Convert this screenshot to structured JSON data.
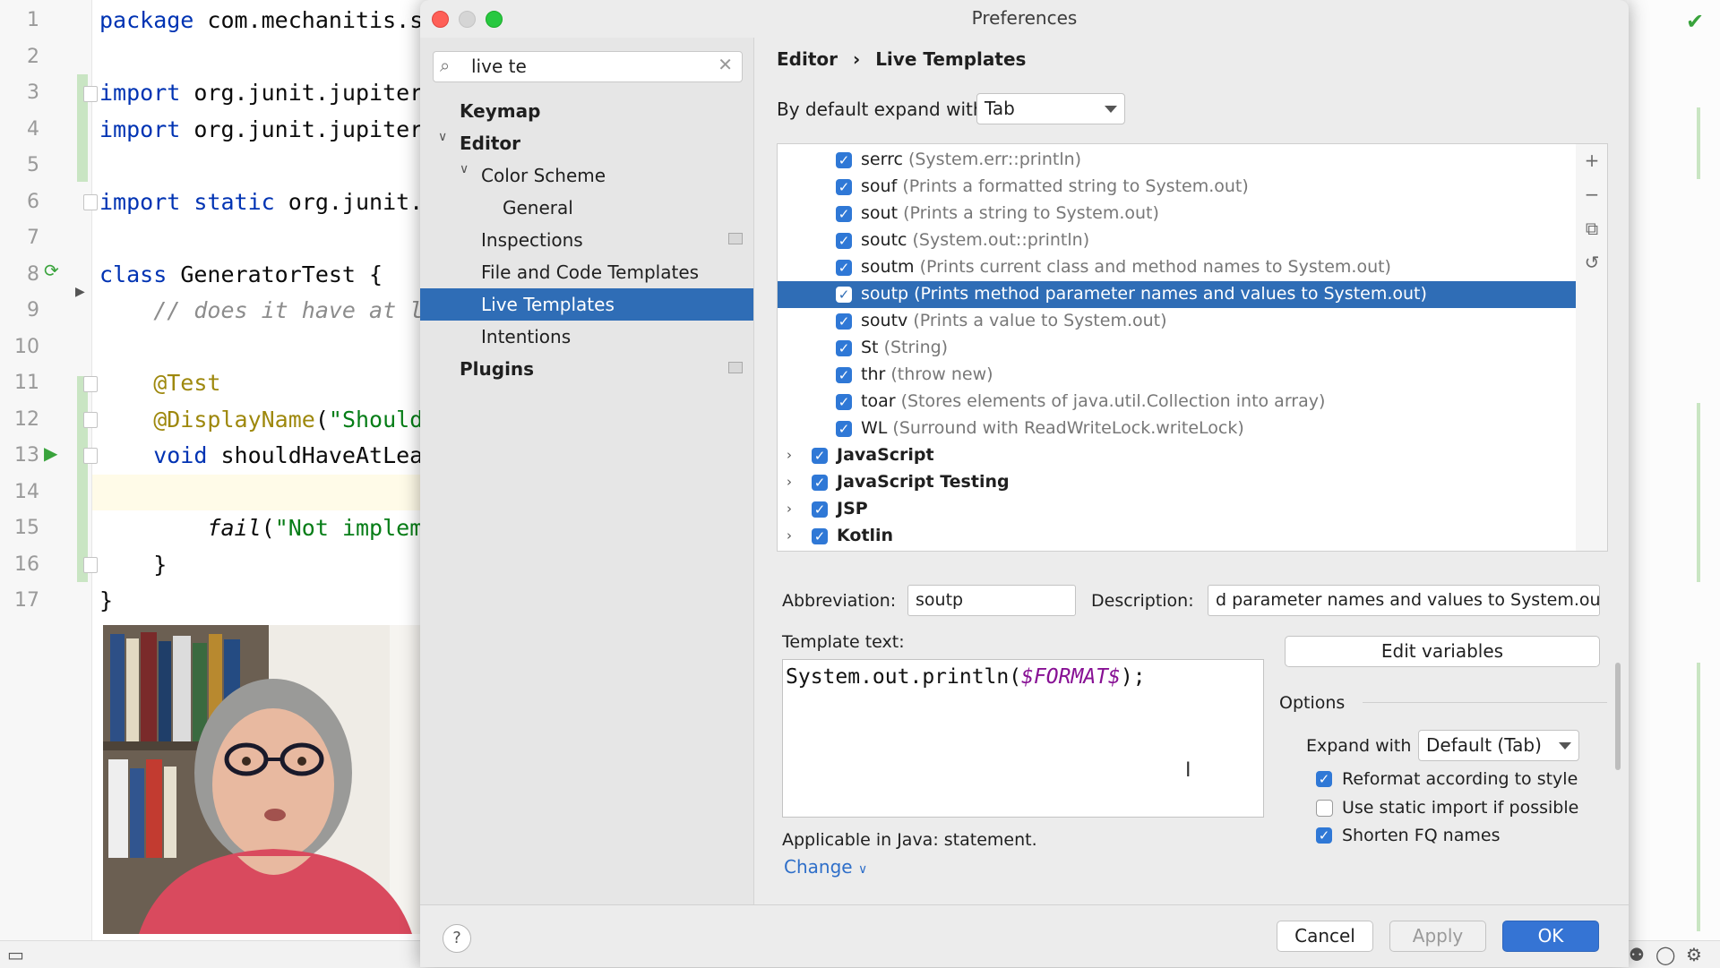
{
  "editor": {
    "lines": [
      {
        "num": "1",
        "html_parts": [
          {
            "t": "package ",
            "c": "kw"
          },
          {
            "t": "com.mechanitis.s",
            "c": ""
          }
        ]
      },
      {
        "num": "2",
        "html_parts": []
      },
      {
        "num": "3",
        "html_parts": [
          {
            "t": "import ",
            "c": "kw"
          },
          {
            "t": "org.junit.jupiter",
            "c": ""
          }
        ]
      },
      {
        "num": "4",
        "html_parts": [
          {
            "t": "import ",
            "c": "kw"
          },
          {
            "t": "org.junit.jupiter",
            "c": ""
          }
        ]
      },
      {
        "num": "5",
        "html_parts": []
      },
      {
        "num": "6",
        "html_parts": [
          {
            "t": "import static ",
            "c": "kw"
          },
          {
            "t": "org.junit.",
            "c": ""
          }
        ]
      },
      {
        "num": "7",
        "html_parts": []
      },
      {
        "num": "8",
        "html_parts": [
          {
            "t": "class ",
            "c": "kw"
          },
          {
            "t": "GeneratorTest {",
            "c": ""
          }
        ]
      },
      {
        "num": "9",
        "html_parts": [
          {
            "t": "    // does it have at l",
            "c": "cm"
          }
        ]
      },
      {
        "num": "10",
        "html_parts": []
      },
      {
        "num": "11",
        "html_parts": [
          {
            "t": "    @Test",
            "c": "an"
          }
        ]
      },
      {
        "num": "12",
        "html_parts": [
          {
            "t": "    @DisplayName",
            "c": "an"
          },
          {
            "t": "(",
            "c": ""
          },
          {
            "t": "\"Should",
            "c": "str"
          }
        ]
      },
      {
        "num": "13",
        "html_parts": [
          {
            "t": "    void ",
            "c": "kw"
          },
          {
            "t": "shouldHaveAtLea",
            "c": ""
          }
        ]
      },
      {
        "num": "14",
        "html_parts": []
      },
      {
        "num": "15",
        "html_parts": [
          {
            "t": "        ",
            "c": ""
          },
          {
            "t": "fail",
            "c": "it"
          },
          {
            "t": "(",
            "c": ""
          },
          {
            "t": "\"Not implem",
            "c": "str"
          }
        ]
      },
      {
        "num": "16",
        "html_parts": [
          {
            "t": "    }",
            "c": ""
          }
        ]
      },
      {
        "num": "17",
        "html_parts": [
          {
            "t": "}",
            "c": ""
          }
        ]
      }
    ]
  },
  "dialog": {
    "title": "Preferences",
    "search": {
      "value": "live te"
    },
    "tree": {
      "keymap": "Keymap",
      "editor": "Editor",
      "color_scheme": "Color Scheme",
      "general": "General",
      "inspections": "Inspections",
      "file_code_templates": "File and Code Templates",
      "live_templates": "Live Templates",
      "intentions": "Intentions",
      "plugins": "Plugins"
    },
    "breadcrumb": {
      "parent": "Editor",
      "sep": "›",
      "current": "Live Templates"
    },
    "expand_with": {
      "label": "By default expand with",
      "value": "Tab"
    },
    "templates": [
      {
        "abbr": "serrc",
        "desc": "(System.err::println)"
      },
      {
        "abbr": "souf",
        "desc": "(Prints a formatted string to System.out)"
      },
      {
        "abbr": "sout",
        "desc": "(Prints a string to System.out)"
      },
      {
        "abbr": "soutc",
        "desc": "(System.out::println)"
      },
      {
        "abbr": "soutm",
        "desc": "(Prints current class and method names to System.out)"
      },
      {
        "abbr": "soutp",
        "desc": "(Prints method parameter names and values to System.out)"
      },
      {
        "abbr": "soutv",
        "desc": "(Prints a value to System.out)"
      },
      {
        "abbr": "St",
        "desc": "(String)"
      },
      {
        "abbr": "thr",
        "desc": "(throw new)"
      },
      {
        "abbr": "toar",
        "desc": "(Stores elements of java.util.Collection into array)"
      },
      {
        "abbr": "WL",
        "desc": "(Surround with ReadWriteLock.writeLock)"
      }
    ],
    "groups": [
      "JavaScript",
      "JavaScript Testing",
      "JSP",
      "Kotlin"
    ],
    "abbreviation": {
      "label": "Abbreviation:",
      "value": "soutp"
    },
    "description": {
      "label": "Description:",
      "value": "d parameter names and values to System.out"
    },
    "template_text": {
      "label": "Template text:",
      "prefix": "System.out.println(",
      "variable": "$FORMAT$",
      "suffix": ");"
    },
    "edit_variables": "Edit variables",
    "options": {
      "title": "Options",
      "expand_label": "Expand with",
      "expand_value": "Default (Tab)",
      "reformat": "Reformat according to style",
      "static_import": "Use static import if possible",
      "shorten_fq": "Shorten FQ names"
    },
    "applicable": "Applicable in Java: statement.",
    "change": "Change",
    "buttons": {
      "cancel": "Cancel",
      "apply": "Apply",
      "ok": "OK",
      "help": "?"
    }
  }
}
